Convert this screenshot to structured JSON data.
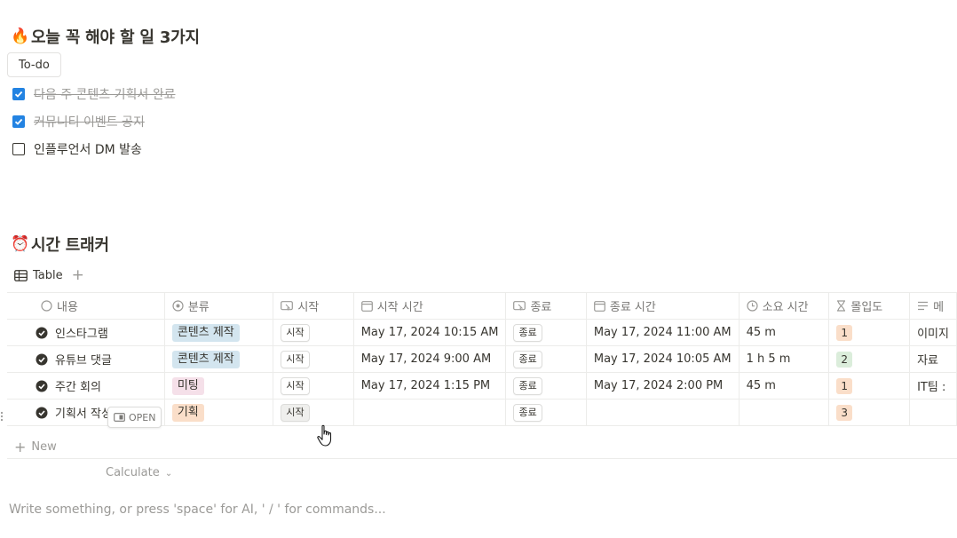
{
  "todo_section": {
    "emoji": "🔥",
    "title": "오늘 꼭 해야 할 일 3가지",
    "tab_label": "To-do",
    "items": [
      {
        "text": "다음 주 콘텐츠 기획서 완료",
        "checked": true
      },
      {
        "text": "커뮤니티 이벤트 공지",
        "checked": true
      },
      {
        "text": "인플루언서 DM 발송",
        "checked": false
      }
    ]
  },
  "tracker_section": {
    "emoji": "⏰",
    "title": "시간 트래커",
    "view_label": "Table",
    "columns": [
      "내용",
      "분류",
      "시작",
      "시작 시간",
      "종료",
      "종료 시간",
      "소요 시간",
      "몰입도",
      "메"
    ],
    "rows": [
      {
        "name": "인스타그램",
        "category": "콘텐츠 제작",
        "start_btn": "시작",
        "start_time": "May 17, 2024 10:15 AM",
        "end_btn": "종료",
        "end_time": "May 17, 2024 11:00 AM",
        "duration": "45 m",
        "focus": "1",
        "memo": "이미지"
      },
      {
        "name": "유튜브 댓글",
        "category": "콘텐츠 제작",
        "start_btn": "시작",
        "start_time": "May 17, 2024 9:00 AM",
        "end_btn": "종료",
        "end_time": "May 17, 2024 10:05 AM",
        "duration": "1 h 5 m",
        "focus": "2",
        "memo": "자료"
      },
      {
        "name": "주간 회의",
        "category": "미팅",
        "start_btn": "시작",
        "start_time": "May 17, 2024 1:15 PM",
        "end_btn": "종료",
        "end_time": "May 17, 2024 2:00 PM",
        "duration": "45 m",
        "focus": "1",
        "memo": "IT팀 :"
      },
      {
        "name": "기획서 작성",
        "category": "기획",
        "start_btn": "시작",
        "start_time": "",
        "end_btn": "종료",
        "end_time": "",
        "duration": "",
        "focus": "3",
        "memo": ""
      }
    ],
    "open_label": "OPEN",
    "new_label": "New",
    "calculate_label": "Calculate"
  },
  "editor_placeholder": "Write something, or press 'space' for AI, ' / ' for commands...",
  "colors": {
    "checkbox_blue": "#2383e2",
    "tag_content": "#d3e5ef",
    "tag_meeting": "#f5e0e9",
    "tag_planning": "#fadec9",
    "focus_1": "#fadec9",
    "focus_2": "#dbeddb",
    "focus_3": "#fadec9"
  }
}
